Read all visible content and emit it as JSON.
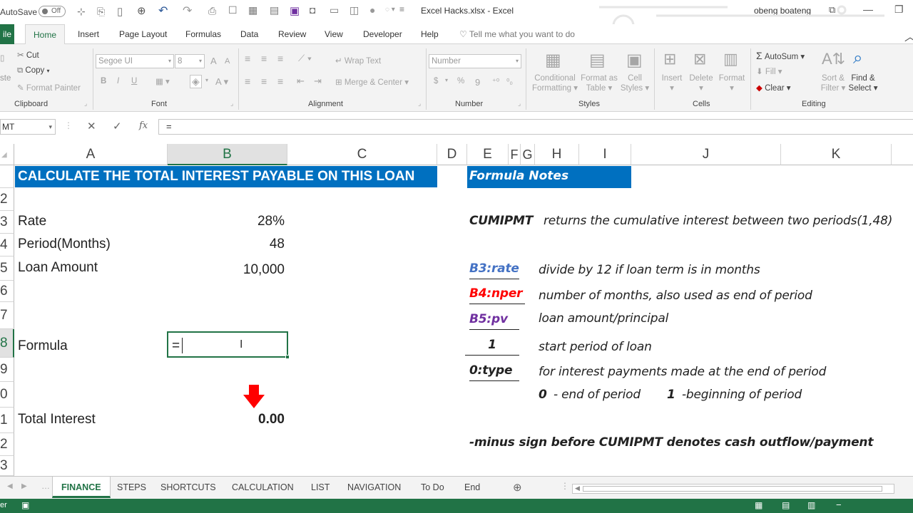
{
  "titlebar": {
    "autosave_label": "AutoSave",
    "autosave_state": "Off",
    "file_title": "Excel Hacks.xlsx  -  Excel",
    "user_name": "obeng boateng"
  },
  "tabs": {
    "file": "ile",
    "home": "Home",
    "insert": "Insert",
    "page_layout": "Page Layout",
    "formulas": "Formulas",
    "data": "Data",
    "review": "Review",
    "view": "View",
    "developer": "Developer",
    "help": "Help",
    "tell_me": "Tell me what you want to do"
  },
  "ribbon": {
    "clipboard": {
      "cut": "Cut",
      "copy": "Copy",
      "format_painter": "Format Painter",
      "paste_stub": "ste",
      "label": "Clipboard"
    },
    "font": {
      "name": "Segoe UI",
      "size": "8",
      "bold": "B",
      "italic": "I",
      "underline": "U",
      "label": "Font"
    },
    "alignment": {
      "wrap_text": "Wrap Text",
      "merge_center": "Merge & Center",
      "label": "Alignment"
    },
    "number": {
      "format": "Number",
      "currency": "$",
      "percent": "%",
      "comma": "9",
      "label": "Number"
    },
    "styles": {
      "conditional_1": "Conditional",
      "conditional_2": "Formatting",
      "table_1": "Format as",
      "table_2": "Table",
      "cell_1": "Cell",
      "cell_2": "Styles",
      "label": "Styles"
    },
    "cells": {
      "insert": "Insert",
      "delete": "Delete",
      "format": "Format",
      "label": "Cells"
    },
    "editing": {
      "autosum": "AutoSum",
      "fill": "Fill",
      "clear": "Clear",
      "sort_1": "Sort &",
      "sort_2": "Filter",
      "find_1": "Find &",
      "find_2": "Select",
      "label": "Editing"
    }
  },
  "formula_bar": {
    "name_box": "MT",
    "fx": "fx",
    "content": "="
  },
  "columns": [
    "A",
    "B",
    "C",
    "D",
    "E",
    "F",
    "G",
    "H",
    "I",
    "J",
    "K"
  ],
  "rows": [
    "2",
    "3",
    "4",
    "5",
    "6",
    "7",
    "8",
    "9",
    "0",
    "1",
    "2",
    "3"
  ],
  "sheet": {
    "header": "CALCULATE THE TOTAL INTEREST PAYABLE ON THIS LOAN",
    "rate_label": "Rate",
    "rate_value": "28%",
    "period_label": "Period(Months)",
    "period_value": "48",
    "loan_label": "Loan Amount",
    "loan_value": "10,000",
    "formula_label": "Formula",
    "formula_value": "=",
    "total_label": "Total Interest",
    "total_value": "0.00"
  },
  "notes": {
    "header": "Formula Notes",
    "cumipmt_name": "CUMIPMT",
    "cumipmt_desc": "returns the cumulative interest between two periods(1,48)",
    "b3": "B3:rate",
    "b3_desc": "divide by 12 if loan term is in months",
    "b4": "B4:nper",
    "b4_desc": "number of months, also used as end of period",
    "b5": "B5:pv",
    "b5_desc": "loan amount/principal",
    "one": "1",
    "one_desc": "start period of loan",
    "type": "0:type",
    "type_desc": "for interest payments made at the end of period",
    "zero_bold": "0",
    "zero_desc": "- end of period",
    "one_bold": "1",
    "one_beg": "-beginning of period",
    "minus_note": "-minus sign before CUMIPMT denotes cash outflow/payment"
  },
  "sheet_tabs": [
    "FINANCE",
    "STEPS",
    "SHORTCUTS",
    "CALCULATION",
    "LIST",
    "NAVIGATION",
    "To Do",
    "End"
  ],
  "status": {
    "mode": "er"
  },
  "colors": {
    "excel_green": "#217346",
    "header_blue": "#0070c0",
    "rate_blue": "#4472c4",
    "nper_red": "#ff0000",
    "pv_purple": "#7030a0"
  }
}
